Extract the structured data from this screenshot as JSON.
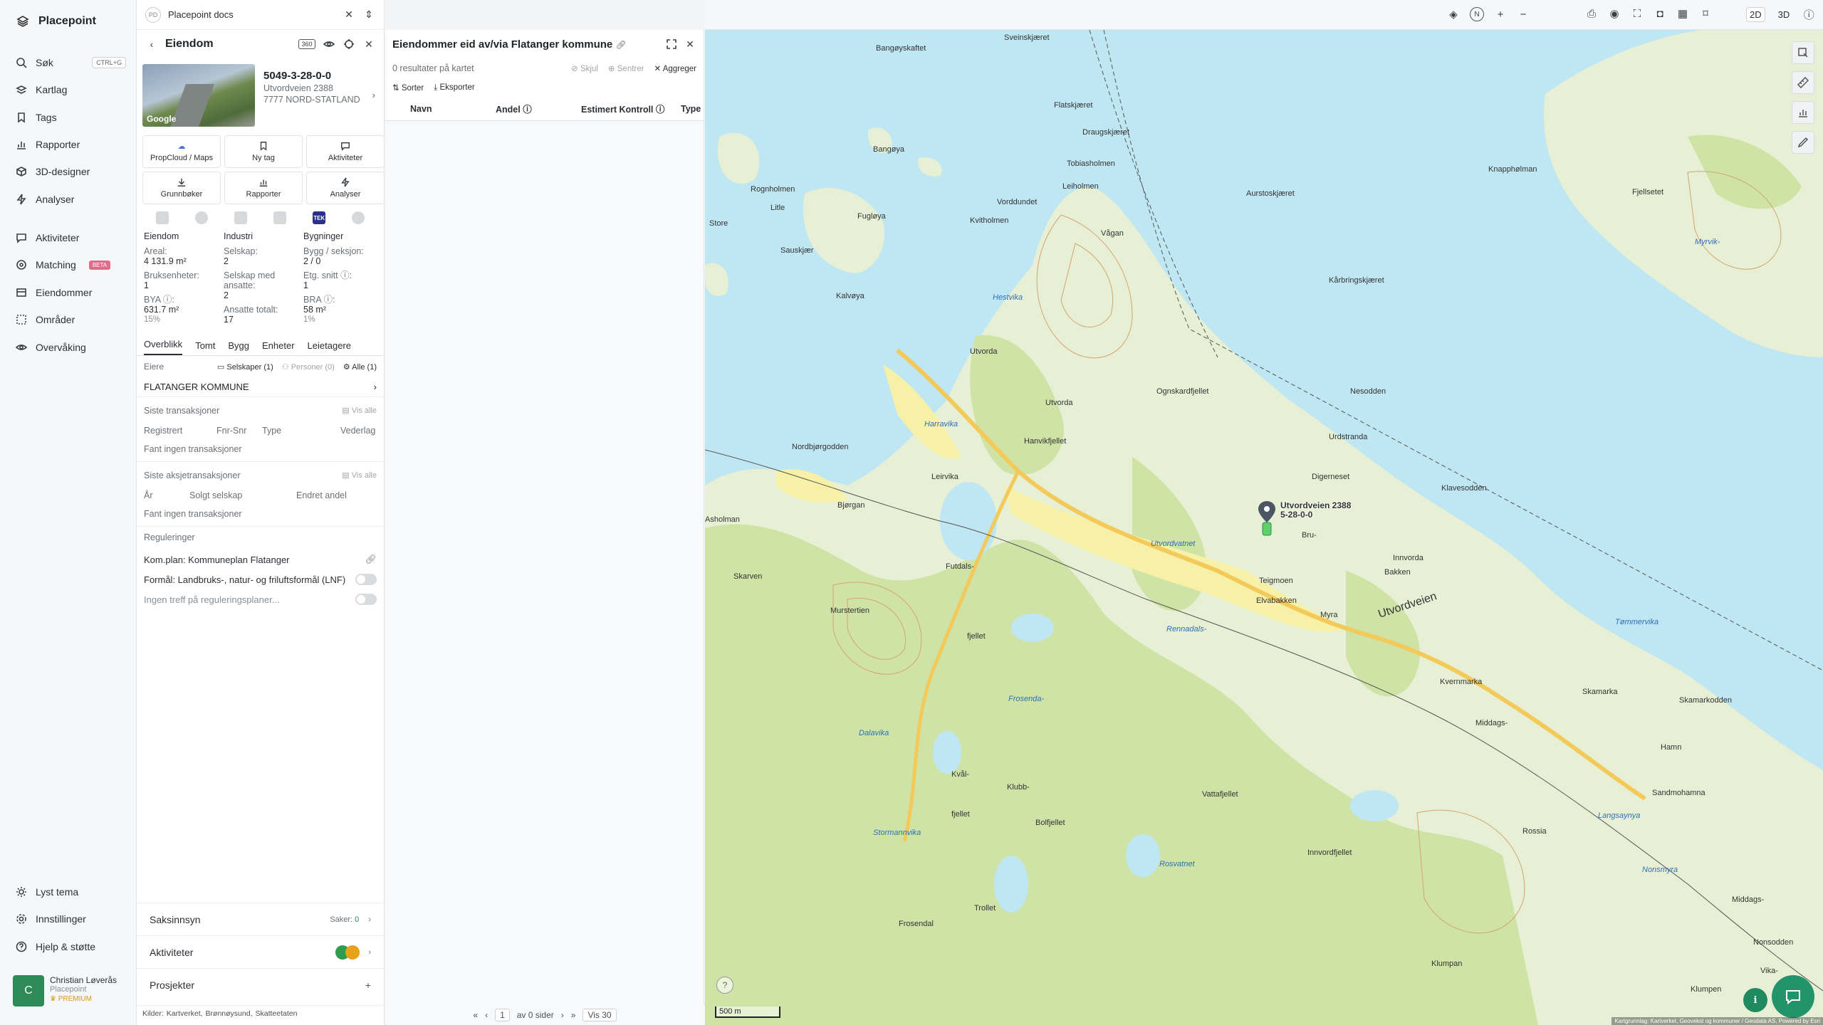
{
  "nav": {
    "brand": "Placepoint",
    "items": [
      {
        "label": "Søk",
        "kbd": "CTRL+G"
      },
      {
        "label": "Kartlag"
      },
      {
        "label": "Tags"
      },
      {
        "label": "Rapporter"
      },
      {
        "label": "3D-designer"
      },
      {
        "label": "Analyser"
      },
      {
        "label": "Aktiviteter"
      },
      {
        "label": "Matching",
        "badge": "BETA"
      },
      {
        "label": "Eiendommer"
      },
      {
        "label": "Områder"
      },
      {
        "label": "Overvåking"
      }
    ],
    "bottom": [
      {
        "label": "Lyst tema"
      },
      {
        "label": "Innstillinger"
      },
      {
        "label": "Hjelp & støtte"
      }
    ],
    "user": {
      "initial": "C",
      "name": "Christian Løverås",
      "org": "Placepoint",
      "plan": "PREMIUM"
    }
  },
  "prop": {
    "doc_badge": "PD",
    "doc_title": "Placepoint docs",
    "header": "Eiendom",
    "id": "5049-3-28-0-0",
    "address1": "Utvordveien 2388",
    "address2": "7777 NORD-STATLAND",
    "google": "Google",
    "buttons": [
      "PropCloud / Maps",
      "Ny tag",
      "Aktiviteter",
      "Grunnbøker",
      "Rapporter",
      "Analyser"
    ],
    "tek": "TEK",
    "stats": {
      "col1": {
        "head": "Eiendom",
        "l1": "Areal:",
        "v1": "4 131.9 m²",
        "l2": "Bruksenheter:",
        "v2": "1",
        "l3": "BYA ⓘ:",
        "v3": "631.7 m²",
        "s3": "15%"
      },
      "col2": {
        "head": "Industri",
        "l1": "Selskap:",
        "v1": "2",
        "l2": "Selskap med ansatte:",
        "v2": "2",
        "l3": "Ansatte totalt:",
        "v3": "17"
      },
      "col3": {
        "head": "Bygninger",
        "l1": "Bygg / seksjon:",
        "v1": "2 / 0",
        "l2": "Etg. snitt ⓘ:",
        "v2": "1",
        "l3": "BRA ⓘ:",
        "v3": "58 m²",
        "s3": "1%"
      }
    },
    "tabs": [
      "Overblikk",
      "Tomt",
      "Bygg",
      "Enheter",
      "Leietagere"
    ],
    "owners": {
      "label": "Eiere",
      "companies": "Selskaper (1)",
      "persons": "Personer (0)",
      "all": "Alle (1)",
      "owner": "FLATANGER KOMMUNE"
    },
    "transactions": {
      "title": "Siste transaksjoner",
      "view_all": "Vis alle",
      "cols": [
        "Registrert",
        "Fnr-Snr",
        "Type",
        "Vederlag"
      ],
      "empty": "Fant ingen transaksjoner"
    },
    "share_tx": {
      "title": "Siste aksjetransaksjoner",
      "view_all": "Vis alle",
      "cols": [
        "År",
        "Solgt selskap",
        "Endret andel"
      ],
      "empty": "Fant ingen transaksjoner"
    },
    "regulations": {
      "title": "Reguleringer",
      "plan": "Kom.plan: Kommuneplan Flatanger",
      "purpose": "Formål: Landbruks-, natur- og friluftsformål (LNF)",
      "none": "Ingen treff på reguleringsplaner..."
    },
    "bottom": {
      "case": "Saksinnsyn",
      "case_meta": "Saker:",
      "case_count": "0",
      "activities": "Aktiviteter",
      "projects": "Prosjekter"
    },
    "sources": {
      "label": "Kilder:",
      "items": [
        "Kartverket,",
        "Brønnøysund,",
        "Skatteetaten"
      ]
    }
  },
  "results": {
    "title": "Eiendommer eid av/via Flatanger kommune",
    "count": "0 resultater på kartet",
    "hide": "Skjul",
    "center": "Sentrer",
    "aggregate": "Aggreger",
    "sort": "Sorter",
    "export": "Eksporter",
    "columns": [
      "Navn",
      "Andel ⓘ",
      "Estimert Kontroll ⓘ",
      "Type"
    ],
    "pager": {
      "page": "1",
      "of": "av 0 sider",
      "per_page": "Vis 30"
    }
  },
  "toolbar": {
    "mode2d": "2D",
    "mode3d": "3D",
    "north": "N"
  },
  "map": {
    "scale": "500 m",
    "attribution": "Kartgrunnlag: Kartverket, Geovekst og kommuner / Geodata AS, Powered by Esri",
    "marker_label": "Utvordveien 2388",
    "marker_sub": "5-28-0-0",
    "labels": [
      {
        "t": "Bangøyskaftet"
      },
      {
        "t": "Sveinskjæret"
      },
      {
        "t": "Flatskjæret"
      },
      {
        "t": "Draugskjæret"
      },
      {
        "t": "Tobiasholmen"
      },
      {
        "t": "Bangøya"
      },
      {
        "t": "Leiholmen"
      },
      {
        "t": "Vorddundet"
      },
      {
        "t": "Kvitholmen"
      },
      {
        "t": "Rognholmen"
      },
      {
        "t": "Fugløya"
      },
      {
        "t": "Sauskjær"
      },
      {
        "t": "Kalvøya"
      },
      {
        "t": "Hestvika",
        "w": true
      },
      {
        "t": "Utvorda"
      },
      {
        "t": "Utvorda"
      },
      {
        "t": "Ognskardfjellet"
      },
      {
        "t": "Hanvikfjellet"
      },
      {
        "t": "Harravika",
        "w": true
      },
      {
        "t": "Nordbjørgodden"
      },
      {
        "t": "Leirvika"
      },
      {
        "t": "Bjørgan"
      },
      {
        "t": "Asholman"
      },
      {
        "t": "Skarven"
      },
      {
        "t": "Murstertien"
      },
      {
        "t": "Futdals-"
      },
      {
        "t": "Utvordvatnet",
        "w": true
      },
      {
        "t": "Bru-"
      },
      {
        "t": "Innvorda"
      },
      {
        "t": "Bakken"
      },
      {
        "t": "Teigmoen"
      },
      {
        "t": "Elvabakken"
      },
      {
        "t": "Myra"
      },
      {
        "t": "Utvordveien",
        "r": true
      },
      {
        "t": "Klavesodden"
      },
      {
        "t": "Digerneset"
      },
      {
        "t": "Urdstranda"
      },
      {
        "t": "Nesodden"
      },
      {
        "t": "Kårbringskjæret"
      },
      {
        "t": "Aurstoskjæret"
      },
      {
        "t": "Knapphølman"
      },
      {
        "t": "Fjellsetet"
      },
      {
        "t": "Myrvik-",
        "w": true
      },
      {
        "t": "Tømmervika",
        "w": true
      },
      {
        "t": "Skamarka"
      },
      {
        "t": "Skamarkodden"
      },
      {
        "t": "Kvernmarka"
      },
      {
        "t": "Middags-"
      },
      {
        "t": "Hamn"
      },
      {
        "t": "Sandmohamna"
      },
      {
        "t": "Rennadals-",
        "w": true
      },
      {
        "t": "Frosenda-",
        "w": true
      },
      {
        "t": "Dalavika",
        "w": true
      },
      {
        "t": "Kvål-"
      },
      {
        "t": "Klubb-"
      },
      {
        "t": "Bolfjellet"
      },
      {
        "t": "Stormannvika",
        "w": true
      },
      {
        "t": "Trollet"
      },
      {
        "t": "Frosendal"
      },
      {
        "t": "Innvordfjellet"
      },
      {
        "t": "Vattafjellet"
      },
      {
        "t": "Rosvatnet",
        "w": true
      },
      {
        "t": "Klumpan"
      },
      {
        "t": "Langsaynya",
        "w": true
      },
      {
        "t": "Nonsmyra",
        "w": true
      },
      {
        "t": "fjellet"
      },
      {
        "t": "fjellet"
      },
      {
        "t": "Middags-"
      },
      {
        "t": "Vika-"
      },
      {
        "t": "Klumpen"
      },
      {
        "t": "Store"
      },
      {
        "t": "Litle"
      },
      {
        "t": "Nonsodden"
      },
      {
        "t": "Vågan"
      },
      {
        "t": "Rossia"
      }
    ]
  }
}
